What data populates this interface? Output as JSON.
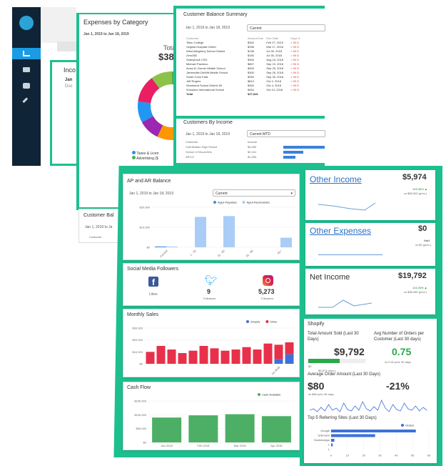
{
  "sidebar": {
    "items": [
      {
        "icon": "logo-icon"
      },
      {
        "icon": "chart-icon"
      },
      {
        "icon": "folder-icon"
      },
      {
        "icon": "camera-icon"
      },
      {
        "icon": "wrench-icon"
      }
    ]
  },
  "expenses": {
    "title": "Expenses by Category",
    "range": "Jan 1, 2019 to Jan 18, 2019",
    "total_label": "Total",
    "total_value": "$38,",
    "legend": [
      "Taxes & Licen",
      "Advertising ($"
    ],
    "chart_data": {
      "type": "pie",
      "slices": [
        {
          "color": "#4caf50",
          "share": 0.4
        },
        {
          "color": "#ff9800",
          "share": 0.17
        },
        {
          "color": "#9c27b0",
          "share": 0.1
        },
        {
          "color": "#2196f3",
          "share": 0.1
        },
        {
          "color": "#e91e63",
          "share": 0.13
        },
        {
          "color": "#8bc34a",
          "share": 0.1
        }
      ]
    }
  },
  "income_partial": {
    "title": "Inco",
    "line1": "Jan",
    "line2": "Doc"
  },
  "customer_balance": {
    "title": "Customer Balance Summary",
    "range": "Jan 1, 2019 to Jan 18, 2019",
    "select": "Current",
    "headers": [
      "Customer",
      "Amount Due",
      "Due Date",
      "Days O"
    ],
    "rows": [
      [
        "Tilton College",
        "$300",
        "Feb 27, 2019",
        "> 90 D"
      ],
      [
        "Virginia Hospital Center",
        "$258",
        "Mar 17, 2018",
        "> 90 D"
      ],
      [
        "West Allegheny School District",
        "$138",
        "Jul 30, 2018",
        "> 90 D"
      ],
      [
        "Zero360",
        "$150",
        "Jul 30, 2018",
        "> 90 D"
      ],
      [
        "Sobeybuck CSD",
        "$300",
        "Aug 16, 2018",
        "> 90 D"
      ],
      [
        "Michael Pacheco",
        "$807",
        "Sep 19, 2018",
        "> 90 D"
      ],
      [
        "Anna M. Dorner Middle School",
        "$300",
        "Sep 25, 2018",
        "> 90 D"
      ],
      [
        "Jamesville-DeWitt Middle School",
        "$300",
        "Sep 26, 2018",
        "> 90 D"
      ],
      [
        "South Cons Falls",
        "$250",
        "Sep 30, 2018",
        "> 90 D"
      ],
      [
        "Jeff Rogers",
        "$814",
        "Oct 2, 2018",
        "> 90 D"
      ],
      [
        "Woodland School District 50",
        "$450",
        "Oct 4, 2018",
        "> 90 D"
      ],
      [
        "Snowdon International School",
        "$454",
        "Oct 13, 2018",
        "> 90 D"
      ]
    ],
    "total_label": "Total",
    "total_value": "$37,828"
  },
  "customers_income": {
    "title": "Customers By Income",
    "range": "Jan 1, 2019 to Jan 18, 2019",
    "select": "Current MTD",
    "headers": [
      "Customer",
      "Income"
    ],
    "rows": [
      [
        "Chentelham High School",
        "$4,550"
      ],
      [
        "School of Visual Arts",
        "$2,161"
      ],
      [
        "ARCO",
        "$1,350"
      ]
    ],
    "chart_data": {
      "type": "bar",
      "values": [
        4550,
        2161,
        1350
      ]
    }
  },
  "cust_bal_partial": {
    "title": "Customer Bal",
    "range": "Jan 1, 2019 to Ja",
    "header": "Customer"
  },
  "ap_ar": {
    "title": "AP and AR Balance",
    "range": "Jan 1, 2019 to Jan 18, 2019",
    "select": "Current",
    "legend": [
      "Aged Payables",
      "Aged Receivables"
    ],
    "chart_data": {
      "type": "bar",
      "categories": [
        "Current",
        "1 - 30",
        "31 - 60",
        "61 - 90",
        "91+"
      ],
      "series": [
        {
          "name": "Aged Payables",
          "values": [
            500,
            0,
            0,
            0,
            0
          ]
        },
        {
          "name": "Aged Receivables",
          "values": [
            500,
            19000,
            19500,
            0,
            6000
          ]
        }
      ],
      "yticks": [
        "$20,000",
        "$10,000",
        "$0"
      ],
      "ylim": [
        0,
        25000
      ]
    }
  },
  "social": {
    "title": "Social Media Followers",
    "facebook": {
      "value": "",
      "label": "Likes"
    },
    "twitter": {
      "value": "9",
      "label": "Followers"
    },
    "instagram": {
      "value": "5,273",
      "label": "Followers"
    }
  },
  "monthly_sales": {
    "title": "Monthly Sales",
    "legend": [
      "Shopify",
      "Other"
    ],
    "chart_data": {
      "type": "bar",
      "categories": [
        "",
        "",
        "",
        "",
        "",
        "",
        "",
        "",
        "",
        "",
        "",
        "",
        "Jul 2018",
        ""
      ],
      "series": [
        {
          "name": "Shopify",
          "values": [
            0,
            0,
            0,
            0,
            0,
            0,
            0,
            0,
            0,
            0,
            0,
            0,
            4000,
            8000
          ]
        },
        {
          "name": "Other",
          "values": [
            10000,
            15000,
            12000,
            9000,
            11000,
            15000,
            13000,
            11000,
            12000,
            14000,
            12000,
            17000,
            12000,
            10000
          ]
        }
      ],
      "yticks": [
        "$30,000",
        "$20,000",
        "$10,000",
        "$0"
      ],
      "ylim": [
        0,
        30000
      ]
    }
  },
  "cash_flow": {
    "title": "Cash Flow",
    "legend": [
      "Cash Available"
    ],
    "chart_data": {
      "type": "bar",
      "categories": [
        "Jan 2018",
        "Feb 2018",
        "Mar 2018",
        "Apr 2018"
      ],
      "values": [
        90000,
        98000,
        102000,
        95000
      ],
      "yticks": [
        "$150,000",
        "$100,000",
        "$50,000",
        "$0"
      ],
      "ylim": [
        0,
        150000
      ]
    }
  },
  "other_income": {
    "title": "Other Income",
    "value": "$5,974",
    "pct": "109.38% ▲",
    "prev": "vs $83,000 (prev.)"
  },
  "other_expenses": {
    "title": "Other Expenses",
    "value": "$0",
    "pct": "NaN",
    "prev": "vs $0 (prev.)"
  },
  "net_income": {
    "title": "Net Income",
    "value": "$19,792",
    "pct": "114.06% ▲",
    "prev": "vs $36,055 (prev.)"
  },
  "shopify": {
    "title": "Shopify",
    "total_label": "Total Amount Sold (Last 30 Days)",
    "total_value": "$9,792",
    "total_bar_min": "$0",
    "total_bar_prev": "$5,873 (prev.)",
    "total_bar_fill": 0.55,
    "avg_orders_label": "Avg Number of Orders per Customer (Last 30 days)",
    "avg_orders_value": "0.75",
    "avg_orders_prev": "vs 0.92 prev 30 days",
    "avg_amount_label": "Average Order Amount (Last 30 Days)",
    "avg_amount_value": "$80",
    "avg_amount_prev": "vs $96 prev 30 days",
    "avg_amount_pct": "-21%",
    "ref_title": "Top 5 Referring Sites (Last 30 Days)",
    "ref_legend": "Orders",
    "ref_chart": {
      "type": "bar",
      "categories": [
        "Google",
        "Unknown",
        "Duckduckgo",
        "t.",
        "L"
      ],
      "values": [
        52,
        27,
        2,
        1,
        0
      ],
      "xticks": [
        "0",
        "10",
        "20",
        "30",
        "40",
        "50",
        "60"
      ],
      "xlim": [
        0,
        60
      ]
    }
  }
}
